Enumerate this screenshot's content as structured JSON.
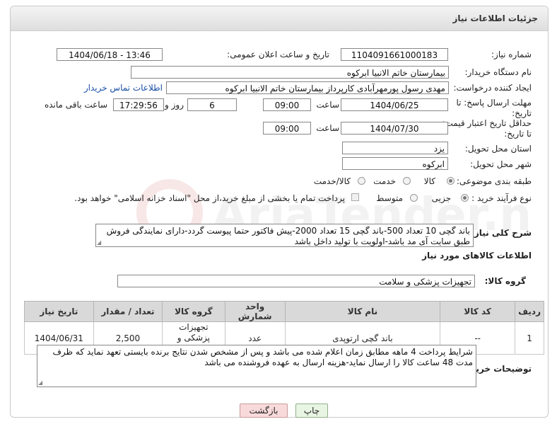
{
  "header": {
    "title": "جزئیات اطلاعات نیاز"
  },
  "fields": {
    "need_number": {
      "label": "شماره نیاز:",
      "value": "1104091661000183"
    },
    "announce": {
      "label": "تاریخ و ساعت اعلان عمومی:",
      "value": "1404/06/18 - 13:46"
    },
    "buyer": {
      "label": "نام دستگاه خریدار:",
      "value": "بیمارستان خاتم الانبیا ابرکوه"
    },
    "creator": {
      "label": "ایجاد کننده درخواست:",
      "value": "مهدی رسول پورمهرآبادی کارپرداز بیمارستان خاتم الانبیا ابرکوه",
      "link": "اطلاعات تماس خریدار"
    },
    "reply_deadline": {
      "label": "مهلت ارسال پاسخ: تا تاریخ:",
      "date": "1404/06/25",
      "time_label": "ساعت",
      "time": "09:00",
      "days": "6",
      "days_label": "روز و",
      "remaining": "17:29:56",
      "remaining_label": "ساعت باقی مانده"
    },
    "price_validity": {
      "label": "حداقل تاریخ اعتبار قیمت: تا تاریخ:",
      "date": "1404/07/30",
      "time_label": "ساعت",
      "time": "09:00"
    },
    "province": {
      "label": "استان محل تحویل:",
      "value": "یزد"
    },
    "city": {
      "label": "شهر محل تحویل:",
      "value": "ابرکوه"
    },
    "category": {
      "label": "طبقه بندی موضوعی:",
      "options": [
        "کالا",
        "خدمت",
        "کالا/خدمت"
      ]
    },
    "process": {
      "label": "نوع فرآیند خرید :",
      "options": [
        "جزیی",
        "متوسط"
      ],
      "payment_note": "پرداخت تمام یا بخشی از مبلغ خرید،از محل \"اسناد خزانه اسلامی\" خواهد بود."
    },
    "summary": {
      "label": "شرح کلی نیاز:",
      "value": "باند گچی 10 تعداد 500-باند گچی 15 تعداد 2000-پیش فاکتور حتما پیوست گردد-دارای نمایندگی فروش طبق سایت آی مد باشد-اولویت با تولید داخل باشد"
    }
  },
  "goods": {
    "section_title": "اطلاعات کالاهای مورد نیاز",
    "group_label": "گروه کالا:",
    "group_value": "تجهیزات پزشکی و سلامت",
    "columns": [
      "ردیف",
      "کد کالا",
      "نام کالا",
      "واحد شمارش",
      "گروه کالا",
      "تعداد / مقدار",
      "تاریخ نیاز"
    ],
    "rows": [
      [
        "1",
        "--",
        "باند گچی ارتوپدی",
        "عدد",
        "تجهیزات پزشکی و سلامت",
        "2,500",
        "1404/06/31"
      ]
    ]
  },
  "buyer_notes": {
    "label": "توضیحات خریدار:",
    "value": "شرایط پرداخت 4 ماهه مطابق زمان اعلام شده می باشد و پس از مشخص شدن نتایج برنده بایستی تعهد نماید که ظرف مدت 48 ساعت کالا را ارسال نماید-هزینه ارسال به عهده فروشنده می باشد"
  },
  "buttons": {
    "print": "چاپ",
    "back": "بازگشت"
  },
  "watermark": {
    "text": "AriaTender.neT"
  },
  "colors": {
    "link": "#1a4fa8",
    "print_bg": "#e9f5e3",
    "back_bg": "#f9dada"
  }
}
